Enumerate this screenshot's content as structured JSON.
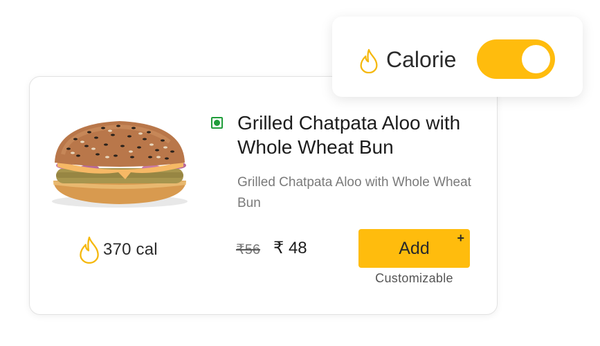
{
  "calorie_toggle": {
    "label": "Calorie",
    "icon": "flame-icon",
    "enabled": true,
    "accent_color": "#FFBC0D"
  },
  "product": {
    "image": "burger-image",
    "veg_indicator": "veg-icon",
    "title": "Grilled Chatpata Aloo with Whole Wheat Bun",
    "description": "Grilled Chatpata Aloo with Whole Wheat Bun",
    "calories": "370 cal",
    "calorie_icon": "flame-icon",
    "price_original": "₹56",
    "price_current": "₹ 48",
    "add_label": "Add",
    "add_icon": "plus-icon",
    "add_symbol": "+",
    "customizable_label": "Customizable",
    "button_color": "#FFBC0D",
    "veg_color": "#1F9D3A"
  }
}
